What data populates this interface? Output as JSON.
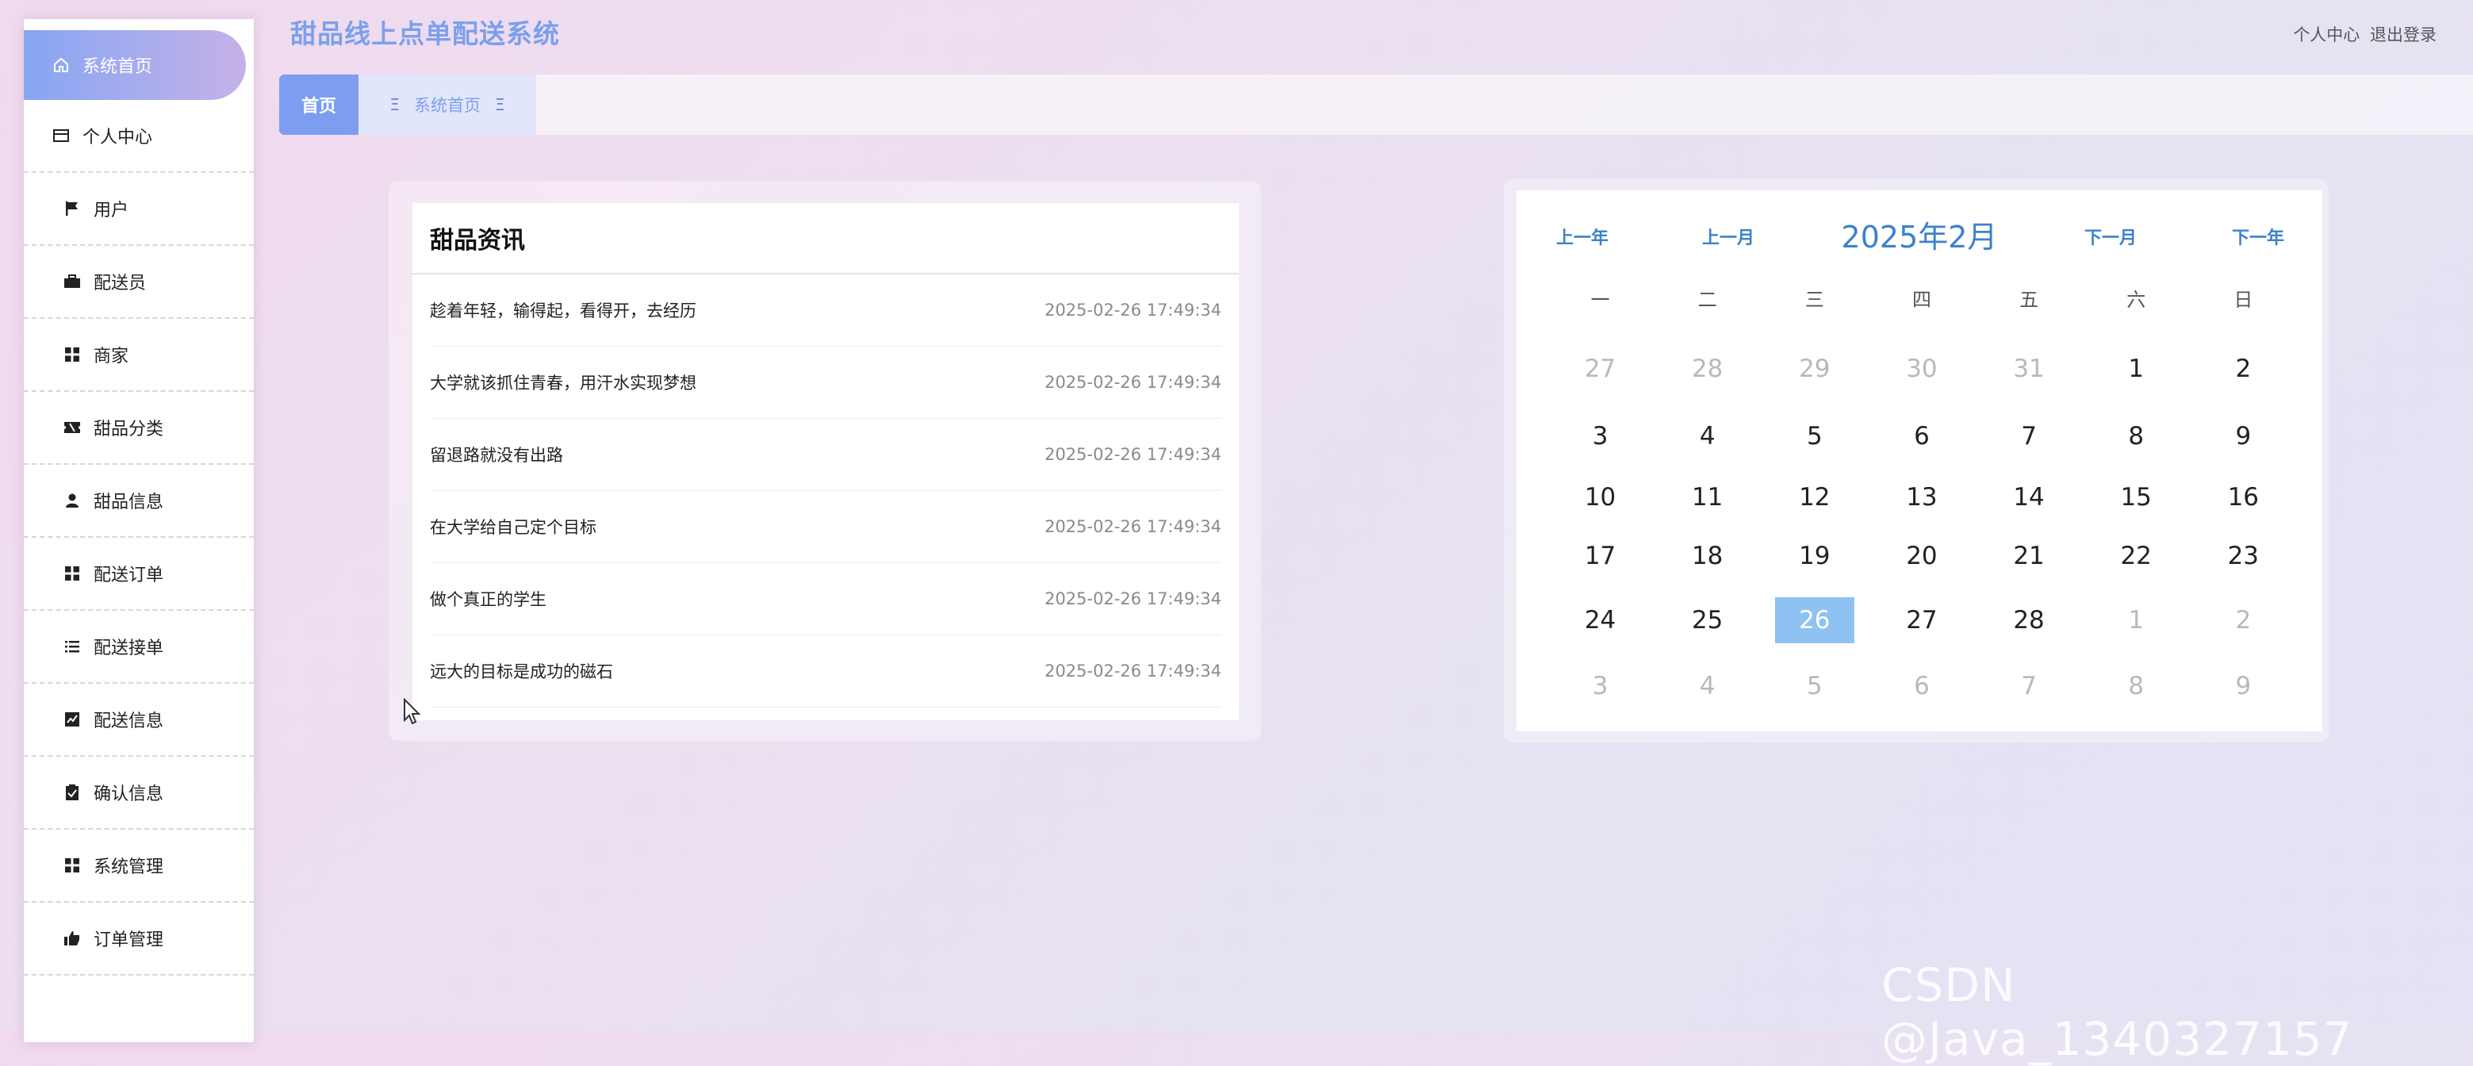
{
  "app": {
    "title": "甜品线上点单配送系统"
  },
  "top_links": {
    "profile": "个人中心",
    "logout": "退出登录"
  },
  "sidebar": {
    "items": [
      {
        "label": "系统首页",
        "icon": "home-icon"
      },
      {
        "label": "个人中心",
        "icon": "wallet-icon"
      },
      {
        "label": "用户",
        "icon": "flag-icon"
      },
      {
        "label": "配送员",
        "icon": "briefcase-icon"
      },
      {
        "label": "商家",
        "icon": "grid-icon"
      },
      {
        "label": "甜品分类",
        "icon": "ticket-icon"
      },
      {
        "label": "甜品信息",
        "icon": "user-icon"
      },
      {
        "label": "配送订单",
        "icon": "grid-icon"
      },
      {
        "label": "配送接单",
        "icon": "list-icon"
      },
      {
        "label": "配送信息",
        "icon": "chart-icon"
      },
      {
        "label": "确认信息",
        "icon": "clipboard-check-icon"
      },
      {
        "label": "系统管理",
        "icon": "grid-icon"
      },
      {
        "label": "订单管理",
        "icon": "thumbs-up-icon"
      }
    ]
  },
  "tabs": {
    "home": "首页",
    "system_home": "系统首页"
  },
  "news": {
    "title": "甜品资讯",
    "items": [
      {
        "title": "趁着年轻，输得起，看得开，去经历",
        "date": "2025-02-26 17:49:34"
      },
      {
        "title": "大学就该抓住青春，用汗水实现梦想",
        "date": "2025-02-26 17:49:34"
      },
      {
        "title": "留退路就没有出路",
        "date": "2025-02-26 17:49:34"
      },
      {
        "title": "在大学给自己定个目标",
        "date": "2025-02-26 17:49:34"
      },
      {
        "title": "做个真正的学生",
        "date": "2025-02-26 17:49:34"
      },
      {
        "title": "远大的目标是成功的磁石",
        "date": "2025-02-26 17:49:34"
      }
    ]
  },
  "calendar": {
    "prev_year": "上一年",
    "prev_month": "上一月",
    "month_title": "2025年2月",
    "next_month": "下一月",
    "next_year": "下一年",
    "weekdays": [
      "一",
      "二",
      "三",
      "四",
      "五",
      "六",
      "日"
    ],
    "weeks": [
      [
        "27",
        "28",
        "29",
        "30",
        "31",
        "1",
        "2"
      ],
      [
        "3",
        "4",
        "5",
        "6",
        "7",
        "8",
        "9"
      ],
      [
        "10",
        "11",
        "12",
        "13",
        "14",
        "15",
        "16"
      ],
      [
        "17",
        "18",
        "19",
        "20",
        "21",
        "22",
        "23"
      ],
      [
        "24",
        "25",
        "26",
        "27",
        "28",
        "1",
        "2"
      ],
      [
        "3",
        "4",
        "5",
        "6",
        "7",
        "8",
        "9"
      ]
    ],
    "today": "26"
  },
  "watermark": "CSDN @Java_1340327157",
  "colors": {
    "accent": "#7d9ef0",
    "calendar_blue": "#3b82c9",
    "today_bg": "#8fc2f2"
  }
}
